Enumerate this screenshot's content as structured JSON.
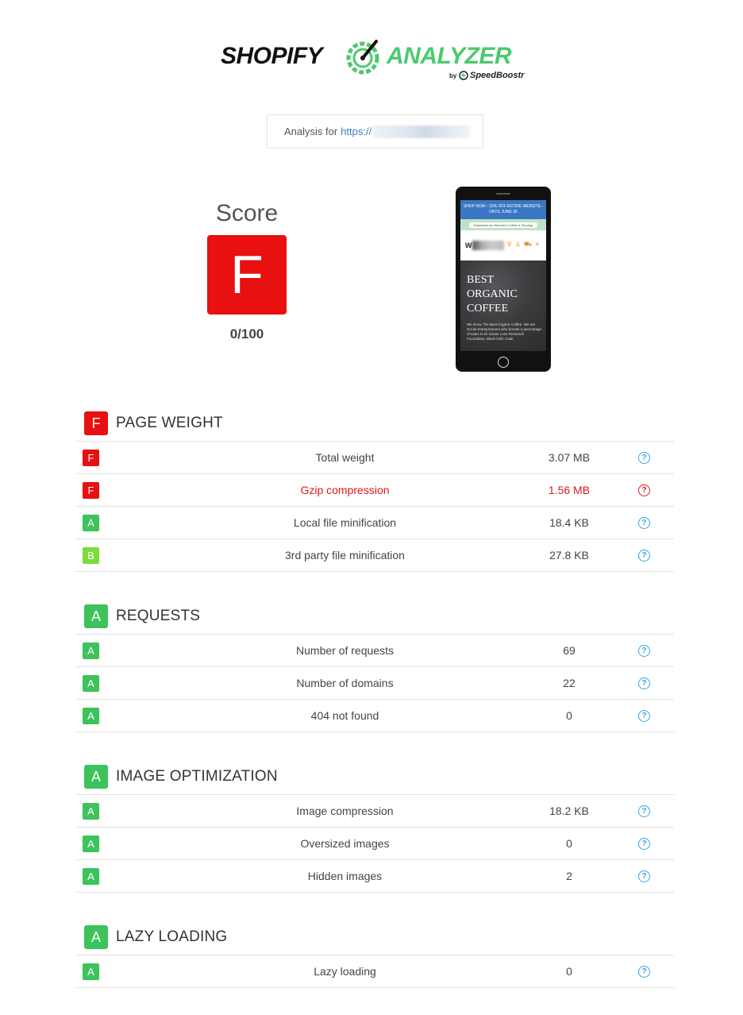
{
  "colors": {
    "grade_F": "#e81010",
    "grade_A": "#3cc35c",
    "grade_B": "#7cdc3c",
    "accent": "#4cc96e",
    "link": "#3a7bbf",
    "help": "#3aa3e0",
    "error": "#e01818"
  },
  "logo": {
    "left": "SHOPIFY",
    "right": "ANALYZER",
    "by": "by",
    "brand": "SpeedBoostr"
  },
  "analysis": {
    "label": "Analysis for",
    "url": "https://"
  },
  "score": {
    "label": "Score",
    "grade": "F",
    "value": "0/100"
  },
  "phone": {
    "banner": "SHOP NOW - 10% OFF ENTIRE WEBSITE - UNTIL JUNE 30",
    "app_button": "Download our Weaver's Coffee & Tea App",
    "brand_initial": "W",
    "hero_title": "BEST ORGANIC COFFEE",
    "hero_text": "We Grow The Best Organic Coffee. We are Social Entrepreneurs who donate a percentage of sales to Dr Susan Love Research Foundation, Black Girls Code"
  },
  "sections": [
    {
      "grade": "F",
      "title": "PAGE WEIGHT",
      "rows": [
        {
          "grade": "F",
          "label": "Total weight",
          "value": "3.07 MB",
          "help": "?"
        },
        {
          "grade": "F",
          "label": "Gzip compression",
          "value": "1.56 MB",
          "help": "?"
        },
        {
          "grade": "A",
          "label": "Local file minification",
          "value": "18.4 KB",
          "help": "?"
        },
        {
          "grade": "B",
          "label": "3rd party file minification",
          "value": "27.8 KB",
          "help": "?"
        }
      ]
    },
    {
      "grade": "A",
      "title": "REQUESTS",
      "rows": [
        {
          "grade": "A",
          "label": "Number of requests",
          "value": "69",
          "help": "?"
        },
        {
          "grade": "A",
          "label": "Number of domains",
          "value": "22",
          "help": "?"
        },
        {
          "grade": "A",
          "label": "404 not found",
          "value": "0",
          "help": "?"
        }
      ]
    },
    {
      "grade": "A",
      "title": "IMAGE OPTIMIZATION",
      "rows": [
        {
          "grade": "A",
          "label": "Image compression",
          "value": "18.2 KB",
          "help": "?"
        },
        {
          "grade": "A",
          "label": "Oversized images",
          "value": "0",
          "help": "?"
        },
        {
          "grade": "A",
          "label": "Hidden images",
          "value": "2",
          "help": "?"
        }
      ]
    },
    {
      "grade": "A",
      "title": "LAZY LOADING",
      "rows": [
        {
          "grade": "A",
          "label": "Lazy loading",
          "value": "0",
          "help": "?"
        }
      ]
    }
  ]
}
